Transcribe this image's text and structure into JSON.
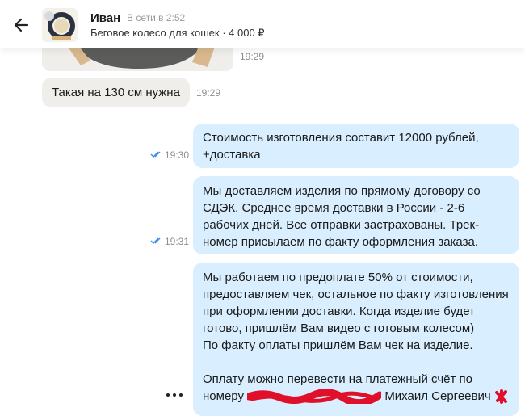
{
  "header": {
    "contact_name": "Иван",
    "status": "В сети в 2:52",
    "listing": "Беговое колесо для кошек · 4 000 ₽",
    "back_icon": "arrow-left-icon"
  },
  "messages": [
    {
      "id": "m0",
      "direction": "in",
      "type": "image",
      "time": "19:29"
    },
    {
      "id": "m1",
      "direction": "in",
      "text": "Такая на 130 см нужна",
      "time": "19:29"
    },
    {
      "id": "m2",
      "direction": "out",
      "lines": [
        "Стоимость изготовления составит 12000 рублей,",
        "+доставка"
      ],
      "time": "19:30",
      "read": true
    },
    {
      "id": "m3",
      "direction": "out",
      "lines": [
        "Мы доставляем изделия по прямому договору со",
        "СДЭК. Среднее время доставки в России - 2-6",
        "рабочих дней. Все отправки застрахованы. Трек-",
        "номер присылаем по факту оформления заказа."
      ],
      "time": "19:31",
      "read": true
    },
    {
      "id": "m4",
      "direction": "out",
      "lines": [
        "Мы работаем по предоплате 50% от стоимости,",
        "предоставляем чек, остальное по факту изготовления",
        "при оформлении доставки. Когда изделие будет",
        "готово, пришлём Вам видео с готовым колесом)",
        "По факту оплаты пришлём Вам чек на изделие.",
        "",
        "Оплату можно перевести на платежный счёт по"
      ],
      "last_line_prefix": "номеру",
      "last_line_name": "Михаил Сергеевич"
    }
  ],
  "colors": {
    "incoming": "#efeeea",
    "outgoing": "#d9efff",
    "read_check": "#3a8ee6",
    "redaction": "#e0102a"
  }
}
